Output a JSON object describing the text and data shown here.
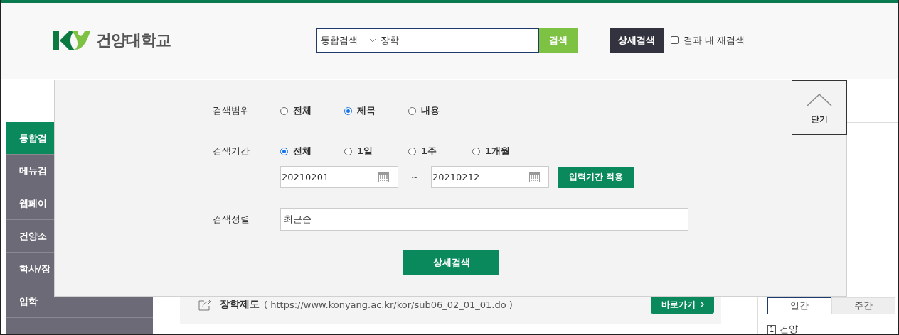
{
  "header": {
    "logo_text": "건양대학교",
    "search": {
      "scope": "통합검색",
      "value": "장학"
    },
    "search_button": "검색",
    "detail_button": "상세검색",
    "refine": {
      "label": "결과 내 재검색",
      "checked": false
    }
  },
  "sidebar": {
    "items": [
      {
        "label": "통합검",
        "selected": true
      },
      {
        "label": "메뉴검",
        "selected": false
      },
      {
        "label": "웹페이",
        "selected": false
      },
      {
        "label": "건양소",
        "selected": false
      },
      {
        "label": "학사/장",
        "selected": false
      },
      {
        "label": "입학",
        "selected": false
      }
    ]
  },
  "result": {
    "title": "장학제도",
    "url": "( https://www.konyang.ac.kr/kor/sub06_02_01_01.do )",
    "button": "바로가기"
  },
  "ranking": {
    "tabs": [
      {
        "label": "일간",
        "selected": true
      },
      {
        "label": "주간",
        "selected": false
      }
    ],
    "items": [
      {
        "rank": "1",
        "text": "건양"
      }
    ]
  },
  "detail_panel": {
    "close_label": "닫기",
    "scope": {
      "label": "검색범위",
      "options": [
        {
          "label": "전체",
          "selected": false
        },
        {
          "label": "제목",
          "selected": true
        },
        {
          "label": "내용",
          "selected": false
        }
      ]
    },
    "period": {
      "label": "검색기간",
      "options": [
        {
          "label": "전체",
          "selected": true
        },
        {
          "label": "1일",
          "selected": false
        },
        {
          "label": "1주",
          "selected": false
        },
        {
          "label": "1개월",
          "selected": false
        }
      ],
      "start": "20210201",
      "separator": "~",
      "end": "20210212",
      "apply_button": "입력기간 적용"
    },
    "sort": {
      "label": "검색정렬",
      "value": "최근순"
    },
    "submit": "상세검색"
  }
}
